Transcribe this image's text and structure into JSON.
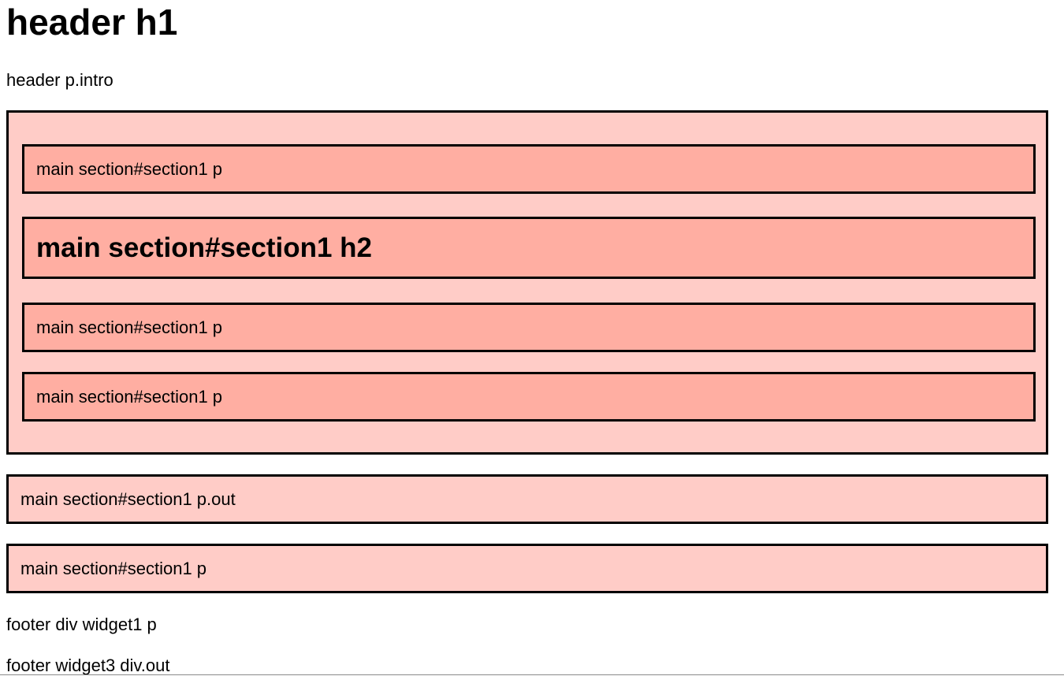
{
  "header": {
    "h1": "header h1",
    "intro": "header p.intro"
  },
  "main": {
    "section1": {
      "items": [
        "main section#section1 p",
        "main section#section1 h2",
        "main section#section1 p",
        "main section#section1 p"
      ]
    },
    "outside": [
      "main section#section1 p.out",
      "main section#section1 p"
    ]
  },
  "footer": {
    "lines": [
      "footer div widget1 p",
      "footer widget3 div.out"
    ]
  },
  "colors": {
    "outer_background": "#ffccc7",
    "inner_background": "#ffaea2",
    "border": "#000000"
  }
}
